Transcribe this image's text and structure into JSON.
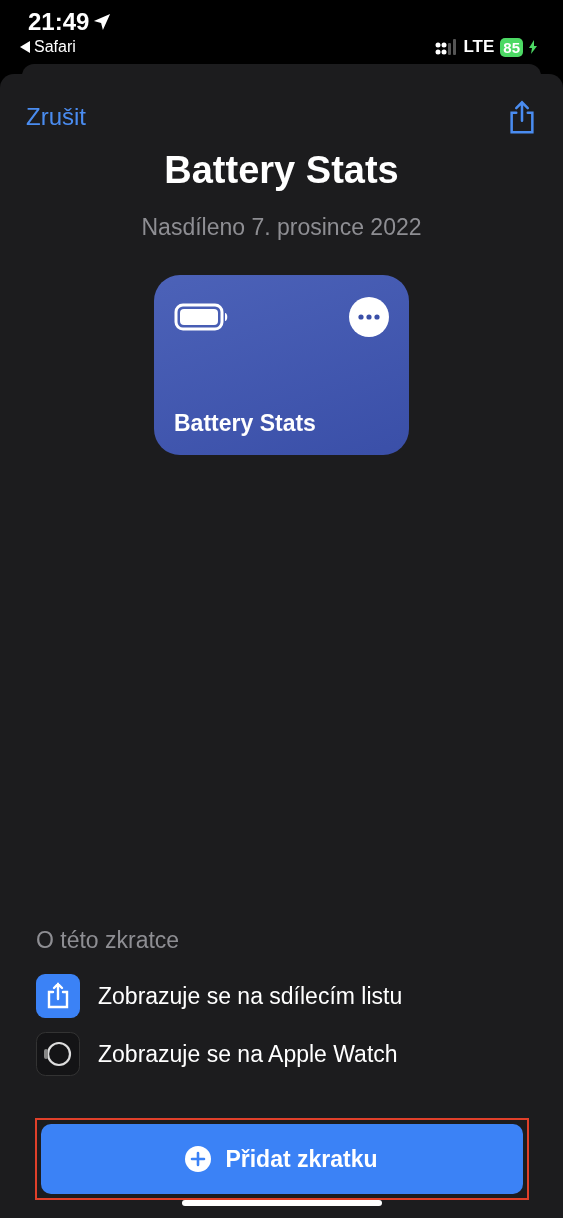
{
  "status_bar": {
    "time": "21:49",
    "back_label": "Safari",
    "network": "LTE",
    "battery": "85",
    "charging": true
  },
  "header": {
    "cancel": "Zrušit"
  },
  "title": "Battery Stats",
  "subtitle": "Nasdíleno 7. prosince 2022",
  "shortcut_card": {
    "name": "Battery Stats"
  },
  "about": {
    "heading": "O této zkratce",
    "items": [
      {
        "kind": "share",
        "label": "Zobrazuje se na sdílecím listu"
      },
      {
        "kind": "watch",
        "label": "Zobrazuje se na Apple Watch"
      }
    ]
  },
  "add_button": {
    "label": "Přidat zkratku",
    "highlighted": true
  }
}
